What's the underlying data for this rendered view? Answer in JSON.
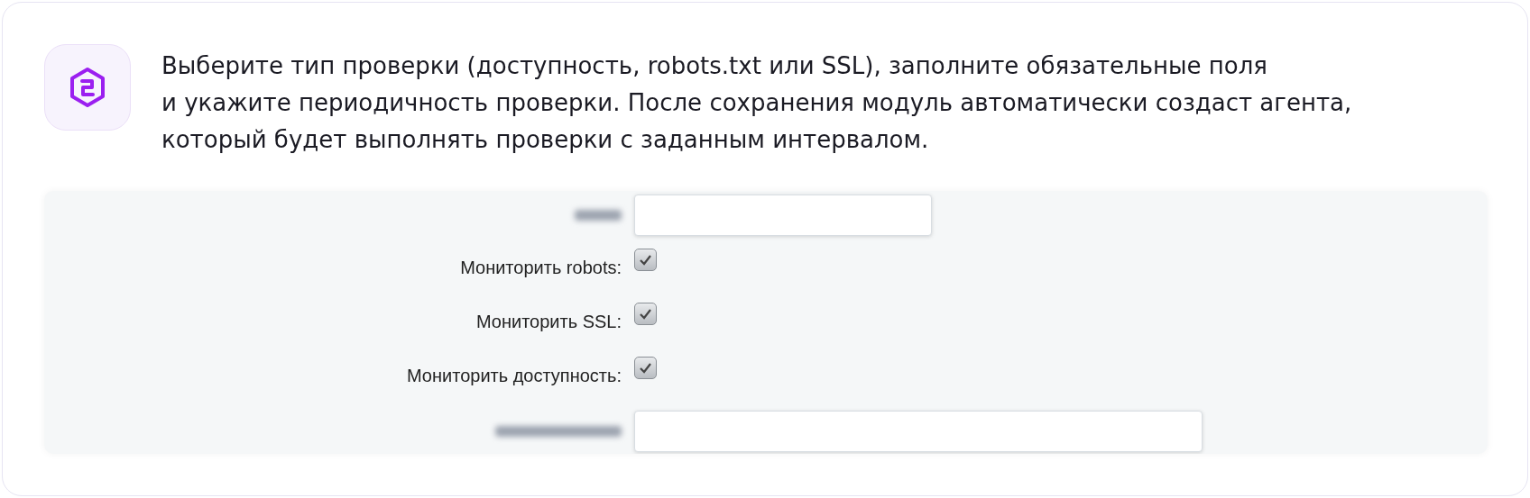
{
  "description": "Выберите тип проверки (доступность, robots.txt или SSL), заполните обязательные поля\nи укажите периодичность проверки. После сохранения модуль автоматически создаст агента,\nкоторый будет выполнять проверки с заданным интервалом.",
  "form_rows": [
    {
      "kind": "field"
    },
    {
      "kind": "checkbox",
      "label": "Мониторить robots:",
      "checked": true
    },
    {
      "kind": "checkbox",
      "label": "Мониторить SSL:",
      "checked": true
    },
    {
      "kind": "checkbox",
      "label": "Мониторить доступность:",
      "checked": true
    },
    {
      "kind": "wide_field"
    }
  ]
}
